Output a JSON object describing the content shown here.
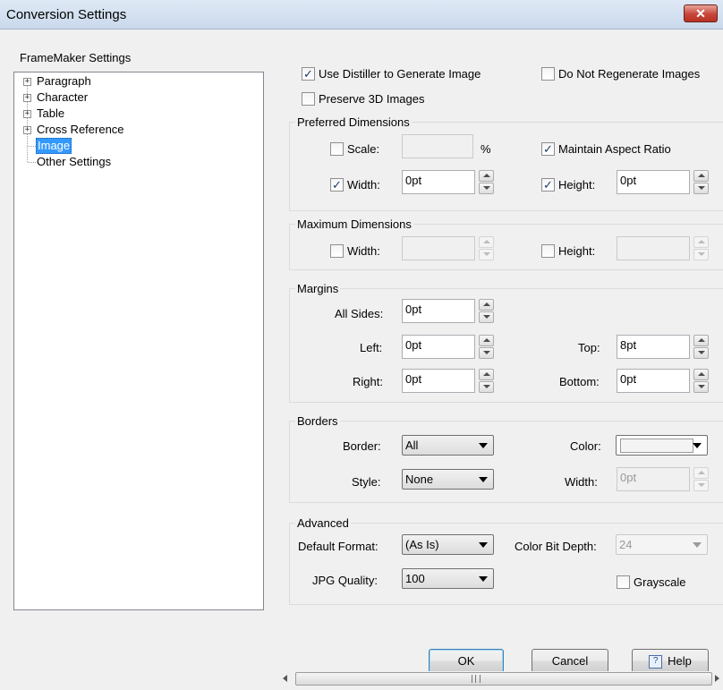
{
  "window": {
    "title": "Conversion Settings",
    "close": "✕"
  },
  "tree": {
    "label": "FrameMaker Settings",
    "items": [
      {
        "label": "Paragraph",
        "expander": "+"
      },
      {
        "label": "Character",
        "expander": "+"
      },
      {
        "label": "Table",
        "expander": "+"
      },
      {
        "label": "Cross Reference",
        "expander": "+"
      },
      {
        "label": "Image",
        "selected": true
      },
      {
        "label": "Other Settings"
      }
    ]
  },
  "options": {
    "use_distiller": {
      "label": "Use Distiller to Generate Image",
      "checked": true
    },
    "do_not_regenerate": {
      "label": "Do Not Regenerate Images",
      "checked": false
    },
    "preserve_3d": {
      "label": "Preserve 3D Images",
      "checked": false
    }
  },
  "preferred": {
    "heading": "Preferred Dimensions",
    "scale_label": "Scale:",
    "scale_value": "",
    "scale_unit": "%",
    "scale_checked": false,
    "maintain_aspect": {
      "label": "Maintain Aspect Ratio",
      "checked": true
    },
    "width_label": "Width:",
    "width_value": "0pt",
    "width_checked": true,
    "height_label": "Height:",
    "height_value": "0pt",
    "height_checked": true
  },
  "maximum": {
    "heading": "Maximum Dimensions",
    "width_label": "Width:",
    "width_value": "",
    "width_checked": false,
    "height_label": "Height:",
    "height_value": "",
    "height_checked": false
  },
  "margins": {
    "heading": "Margins",
    "all_label": "All Sides:",
    "all_value": "0pt",
    "left_label": "Left:",
    "left_value": "0pt",
    "top_label": "Top:",
    "top_value": "8pt",
    "right_label": "Right:",
    "right_value": "0pt",
    "bottom_label": "Bottom:",
    "bottom_value": "0pt"
  },
  "borders": {
    "heading": "Borders",
    "border_label": "Border:",
    "border_value": "All",
    "color_label": "Color:",
    "color_value": "",
    "style_label": "Style:",
    "style_value": "None",
    "width_label": "Width:",
    "width_value": "0pt"
  },
  "advanced": {
    "heading": "Advanced",
    "format_label": "Default Format:",
    "format_value": "(As Is)",
    "depth_label": "Color Bit Depth:",
    "depth_value": "24",
    "jpg_label": "JPG Quality:",
    "jpg_value": "100",
    "grayscale": {
      "label": "Grayscale",
      "checked": false
    }
  },
  "buttons": {
    "ok": "OK",
    "cancel": "Cancel",
    "help": "Help",
    "help_icon": "?"
  },
  "colors": {
    "selection": "#3399ff",
    "check": "#1c3d6e"
  }
}
